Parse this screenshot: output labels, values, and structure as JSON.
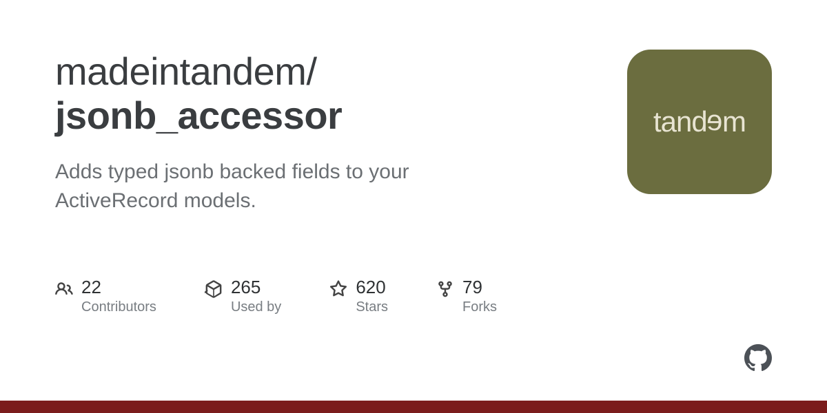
{
  "repo": {
    "owner": "madeintandem",
    "separator": "/",
    "name": "jsonb_accessor",
    "description": "Adds typed jsonb backed fields to your ActiveRecord models."
  },
  "stats": {
    "contributors": {
      "count": "22",
      "label": "Contributors"
    },
    "usedby": {
      "count": "265",
      "label": "Used by"
    },
    "stars": {
      "count": "620",
      "label": "Stars"
    },
    "forks": {
      "count": "79",
      "label": "Forks"
    }
  },
  "logo": {
    "text_left": "tand",
    "text_e": "e",
    "text_right": "m"
  },
  "colors": {
    "accent_bar": "#7b1c1c",
    "logo_bg": "#6b6d3f"
  }
}
